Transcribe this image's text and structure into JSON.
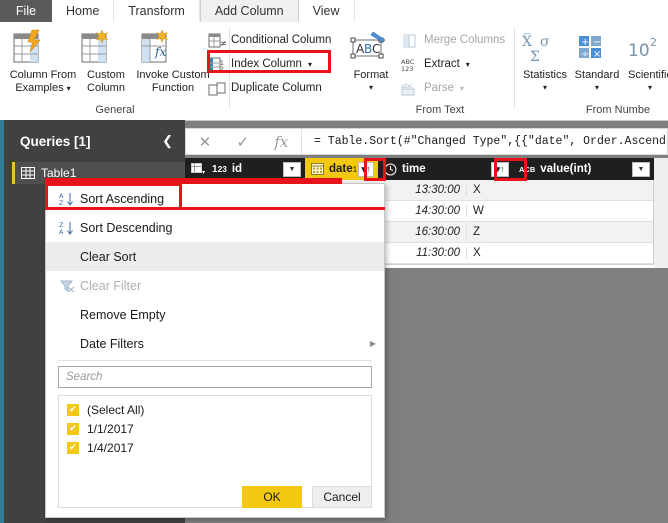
{
  "window": {
    "accent_teal": "#2d7d9a",
    "accent_yellow": "#f2c811",
    "annotation_color": "#e8131a"
  },
  "ribbon": {
    "tabs": [
      {
        "label": "File",
        "state": "file"
      },
      {
        "label": "Home",
        "state": "normal"
      },
      {
        "label": "Transform",
        "state": "normal"
      },
      {
        "label": "Add Column",
        "state": "active"
      },
      {
        "label": "View",
        "state": "normal"
      }
    ],
    "groups": [
      {
        "name": "General",
        "label": "General",
        "big_buttons": [
          {
            "label_line1": "Column From",
            "label_line2": "Examples",
            "has_caret": true,
            "icon": "column-from-examples-icon"
          },
          {
            "label_line1": "Custom",
            "label_line2": "Column",
            "has_caret": false,
            "icon": "custom-column-icon"
          },
          {
            "label_line1": "Invoke Custom",
            "label_line2": "Function",
            "has_caret": false,
            "icon": "invoke-custom-function-icon"
          }
        ],
        "small_buttons": [
          {
            "label": "Conditional Column",
            "icon": "conditional-column-icon",
            "disabled": false,
            "caret": false
          },
          {
            "label": "Index Column",
            "icon": "index-column-icon",
            "disabled": false,
            "caret": true,
            "highlighted": true
          },
          {
            "label": "Duplicate Column",
            "icon": "duplicate-column-icon",
            "disabled": false,
            "caret": false
          }
        ]
      },
      {
        "name": "From Text",
        "label": "From Text",
        "big_buttons": [
          {
            "label_line1": "Format",
            "label_line2": "",
            "has_caret": true,
            "icon": "format-abc-icon"
          }
        ],
        "small_buttons": [
          {
            "label": "Merge Columns",
            "icon": "merge-columns-icon",
            "disabled": true,
            "caret": false
          },
          {
            "label": "Extract",
            "icon": "extract-abc123-icon",
            "disabled": false,
            "caret": true
          },
          {
            "label": "Parse",
            "icon": "parse-icon",
            "disabled": true,
            "caret": true
          }
        ]
      },
      {
        "name": "From Number",
        "label": "From Numbe",
        "big_buttons": [
          {
            "label_line1": "Statistics",
            "label_line2": "",
            "has_caret": true,
            "icon": "statistics-sigma-icon"
          },
          {
            "label_line1": "Standard",
            "label_line2": "",
            "has_caret": true,
            "icon": "standard-operators-icon"
          },
          {
            "label_line1": "Scientific",
            "label_line2": "",
            "has_caret": true,
            "icon": "scientific-power-icon"
          }
        ],
        "small_buttons": []
      }
    ]
  },
  "formula_bar": {
    "cancel_icon": "cancel-x-icon",
    "accept_icon": "accept-check-icon",
    "fx_icon": "fx-icon",
    "formula": "= Table.Sort(#\"Changed Type\",{{\"date\", Order.Ascending}"
  },
  "queries_pane": {
    "title": "Queries [1]",
    "collapse_icon": "chevron-left-icon",
    "items": [
      {
        "label": "Table1",
        "icon": "table-icon"
      }
    ]
  },
  "grid": {
    "columns": [
      {
        "header": "id",
        "type_icon": "123-whole-number-icon",
        "has_dropdown": true,
        "selected": false
      },
      {
        "header": "date",
        "type_icon": "calendar-date-icon",
        "has_dropdown": true,
        "selected": true,
        "sort_glyph": "1"
      },
      {
        "header": "time",
        "type_icon": "clock-time-icon",
        "has_dropdown": true,
        "selected": false,
        "sort_glyph": ""
      },
      {
        "header": "value(int)",
        "type_icon": "abc-text-icon",
        "has_dropdown": true,
        "selected": false
      }
    ],
    "rows": [
      {
        "id": "",
        "date": "",
        "time": "13:30:00",
        "value": "X"
      },
      {
        "id": "",
        "date": "",
        "time": "14:30:00",
        "value": "W"
      },
      {
        "id": "",
        "date": "",
        "time": "16:30:00",
        "value": "Z"
      },
      {
        "id": "",
        "date": "",
        "time": "11:30:00",
        "value": "X"
      }
    ]
  },
  "filter_menu": {
    "items": [
      {
        "label": "Sort Ascending",
        "icon": "sort-az-ascending-icon",
        "disabled": false,
        "highlighted": false,
        "annotated": true,
        "submenu": false
      },
      {
        "label": "Sort Descending",
        "icon": "sort-za-descending-icon",
        "disabled": false,
        "highlighted": false,
        "annotated": false,
        "submenu": false
      },
      {
        "label": "Clear Sort",
        "icon": "",
        "disabled": false,
        "highlighted": true,
        "annotated": false,
        "submenu": false
      },
      {
        "label": "Clear Filter",
        "icon": "clear-filter-icon",
        "disabled": true,
        "highlighted": false,
        "annotated": false,
        "submenu": false
      },
      {
        "label": "Remove Empty",
        "icon": "",
        "disabled": false,
        "highlighted": false,
        "annotated": false,
        "submenu": false
      },
      {
        "label": "Date Filters",
        "icon": "",
        "disabled": false,
        "highlighted": false,
        "annotated": false,
        "submenu": true
      }
    ],
    "search_placeholder": "Search",
    "checkbox_items": [
      {
        "label": "(Select All)",
        "checked": true
      },
      {
        "label": "1/1/2017",
        "checked": true
      },
      {
        "label": "1/4/2017",
        "checked": true
      }
    ],
    "ok_label": "OK",
    "cancel_label": "Cancel",
    "check_glyph": "✔"
  },
  "annotations": [
    {
      "name": "index-column-highlight"
    },
    {
      "name": "date-sort-button-highlight"
    },
    {
      "name": "time-sort-button-highlight"
    },
    {
      "name": "sort-ascending-menu-highlight"
    },
    {
      "name": "query-item-highlight"
    }
  ]
}
